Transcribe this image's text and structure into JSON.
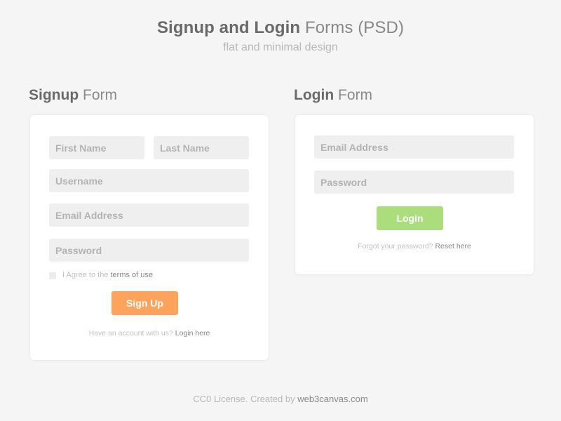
{
  "header": {
    "title_bold": "Signup and Login",
    "title_light": "Forms (PSD)",
    "subtitle": "flat and minimal design"
  },
  "signup": {
    "title_bold": "Signup",
    "title_light": "Form",
    "fields": {
      "first_name": {
        "placeholder": "First Name",
        "value": ""
      },
      "last_name": {
        "placeholder": "Last Name",
        "value": ""
      },
      "username": {
        "placeholder": "Username",
        "value": ""
      },
      "email": {
        "placeholder": "Email Address",
        "value": ""
      },
      "password": {
        "placeholder": "Password",
        "value": ""
      }
    },
    "agree_text": "I Agree to the",
    "terms_link": "terms of use",
    "agree_checked": false,
    "button_label": "Sign Up",
    "button_color": "#fda35c",
    "helper_text": "Have an account with us?",
    "helper_link": "Login here"
  },
  "login": {
    "title_bold": "Login",
    "title_light": "Form",
    "fields": {
      "email": {
        "placeholder": "Email Address",
        "value": ""
      },
      "password": {
        "placeholder": "Password",
        "value": ""
      }
    },
    "button_label": "Login",
    "button_color": "#abdd7c",
    "helper_text": "Forgot your password?",
    "helper_link": "Reset here"
  },
  "footer": {
    "text": "CC0 License. Created by",
    "link": "web3canvas.com"
  }
}
